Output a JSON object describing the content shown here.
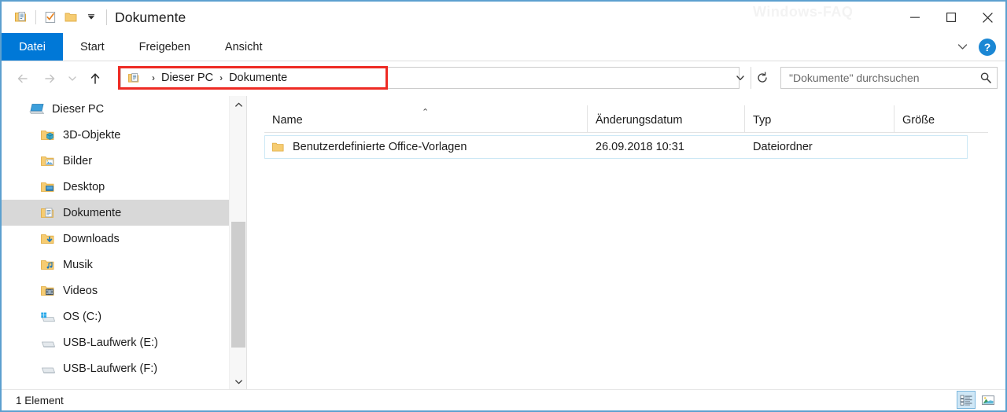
{
  "window": {
    "title": "Dokumente",
    "watermark": "Windows-FAQ",
    "accent_color": "#0078d7",
    "highlight_color": "#ee2b24",
    "border_color": "#5ca0cf"
  },
  "quick_access_toolbar": {
    "items": [
      {
        "name": "properties-documents-icon",
        "label": "Eigenschaften"
      },
      {
        "name": "new-item-checkmark-icon",
        "label": "Neues Element"
      },
      {
        "name": "new-folder-icon",
        "label": "Neuer Ordner"
      },
      {
        "name": "customize-dropdown-icon",
        "label": "Symbolleiste anpassen"
      }
    ]
  },
  "window_controls": {
    "minimize": "Minimieren",
    "maximize": "Maximieren",
    "close": "Schließen"
  },
  "ribbon": {
    "tabs": [
      {
        "label": "Datei",
        "active": true
      },
      {
        "label": "Start",
        "active": false
      },
      {
        "label": "Freigeben",
        "active": false
      },
      {
        "label": "Ansicht",
        "active": false
      }
    ],
    "expand_label": "Menüband erweitern",
    "help_label": "?"
  },
  "navigation": {
    "back_label": "Zurück",
    "forward_label": "Vorwärts",
    "recent_label": "Zuletzt besuchte Orte",
    "up_label": "Nach oben",
    "refresh_label": "Aktualisieren",
    "dropdown_label": "Vorherige Orte"
  },
  "address": {
    "icon": "documents-folder-icon",
    "crumbs": [
      "Dieser PC",
      "Dokumente"
    ],
    "separator": "›"
  },
  "search": {
    "placeholder": "\"Dokumente\" durchsuchen",
    "value": "",
    "icon": "search-icon"
  },
  "sidebar": {
    "items": [
      {
        "label": "Dieser PC",
        "icon": "this-pc-icon",
        "level": 0,
        "selected": false
      },
      {
        "label": "3D-Objekte",
        "icon": "folder-3d-icon",
        "level": 1,
        "selected": false
      },
      {
        "label": "Bilder",
        "icon": "folder-pictures-icon",
        "level": 1,
        "selected": false
      },
      {
        "label": "Desktop",
        "icon": "folder-desktop-icon",
        "level": 1,
        "selected": false
      },
      {
        "label": "Dokumente",
        "icon": "folder-documents-icon",
        "level": 1,
        "selected": true
      },
      {
        "label": "Downloads",
        "icon": "folder-downloads-icon",
        "level": 1,
        "selected": false
      },
      {
        "label": "Musik",
        "icon": "folder-music-icon",
        "level": 1,
        "selected": false
      },
      {
        "label": "Videos",
        "icon": "folder-videos-icon",
        "level": 1,
        "selected": false
      },
      {
        "label": "OS (C:)",
        "icon": "windows-drive-icon",
        "level": 1,
        "selected": false
      },
      {
        "label": "USB-Laufwerk (E:)",
        "icon": "drive-icon",
        "level": 1,
        "selected": false
      },
      {
        "label": "USB-Laufwerk (F:)",
        "icon": "drive-icon",
        "level": 1,
        "selected": false
      }
    ],
    "scrollbar": {
      "up": "⌃",
      "down": "⌄"
    }
  },
  "file_list": {
    "columns": [
      {
        "label": "Name",
        "sorted": "asc"
      },
      {
        "label": "Änderungsdatum",
        "sorted": ""
      },
      {
        "label": "Typ",
        "sorted": ""
      },
      {
        "label": "Größe",
        "sorted": ""
      }
    ],
    "sort_caret": "⌃",
    "rows": [
      {
        "icon": "folder-icon",
        "name": "Benutzerdefinierte Office-Vorlagen",
        "date": "26.09.2018 10:31",
        "type": "Dateiordner",
        "size": ""
      }
    ]
  },
  "status_bar": {
    "text": "1 Element",
    "views": [
      {
        "name": "details-view-button",
        "label": "Detailansicht",
        "active": true
      },
      {
        "name": "large-icons-view-button",
        "label": "Große Symbole",
        "active": false
      }
    ]
  }
}
